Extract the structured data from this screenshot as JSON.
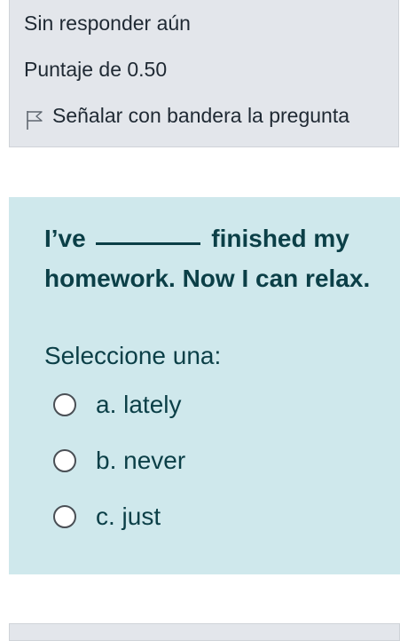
{
  "status": {
    "state": "Sin responder aún",
    "score": "Puntaje de 0.50",
    "flag_label": "Señalar con bandera la pregunta",
    "flag_icon": "flag-icon"
  },
  "question": {
    "text_before": "I’ve",
    "text_after": "finished my homework. Now I can relax.",
    "select_prompt": "Seleccione una:",
    "options": [
      {
        "label": "a. lately",
        "selected": false
      },
      {
        "label": "b. never",
        "selected": false
      },
      {
        "label": "c. just",
        "selected": false
      }
    ]
  },
  "colors": {
    "info_bg": "#e3e6eb",
    "question_bg": "#cfe8ec",
    "question_text": "#0b3f47"
  }
}
